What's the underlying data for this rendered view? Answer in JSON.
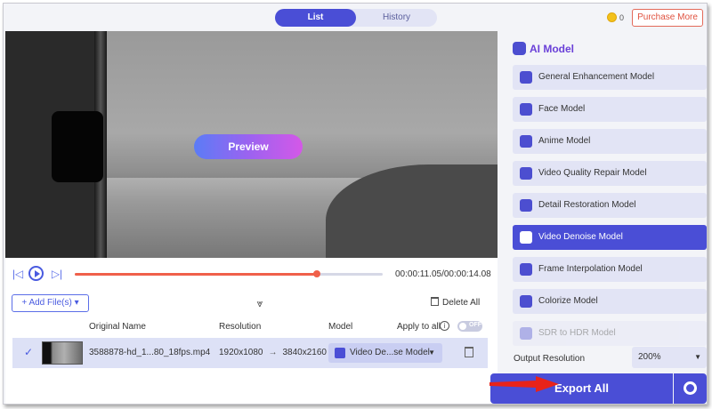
{
  "tabs": [
    {
      "label": "List",
      "active": true
    },
    {
      "label": "History",
      "active": false
    }
  ],
  "header": {
    "coin_count": "0",
    "purchase_label": "Purchase More"
  },
  "preview": {
    "button_label": "Preview"
  },
  "player": {
    "time": "00:00:11.05/00:00:14.08",
    "progress": 0.786
  },
  "filebar": {
    "add_label": "Add File(s)",
    "delete_all_label": "Delete All"
  },
  "table": {
    "columns": {
      "name": "Original Name",
      "resolution": "Resolution",
      "model": "Model",
      "apply_all": "Apply to all",
      "toggle": "OFF"
    },
    "rows": [
      {
        "name": "3588878-hd_1...80_18fps.mp4",
        "res_from": "1920x1080",
        "res_to": "3840x2160",
        "model": "Video De...se Model"
      }
    ]
  },
  "sidebar": {
    "title": "AI Model",
    "models": [
      {
        "label": "General Enhancement Model",
        "icon": "enhance-icon",
        "state": "normal"
      },
      {
        "label": "Face Model",
        "icon": "face-icon",
        "state": "normal"
      },
      {
        "label": "Anime Model",
        "icon": "anime-icon",
        "state": "normal"
      },
      {
        "label": "Video Quality Repair Model",
        "icon": "repair-icon",
        "state": "normal"
      },
      {
        "label": "Detail Restoration Model",
        "icon": "detail-icon",
        "state": "normal"
      },
      {
        "label": "Video Denoise Model",
        "icon": "denoise-icon",
        "state": "active"
      },
      {
        "label": "Frame Interpolation Model",
        "icon": "frame-icon",
        "state": "normal"
      },
      {
        "label": "Colorize Model",
        "icon": "colorize-icon",
        "state": "normal"
      },
      {
        "label": "SDR to HDR Model",
        "icon": "hdr-icon",
        "state": "faded"
      }
    ],
    "output_label": "Output Resolution",
    "output_value": "200%",
    "export_label": "Export All"
  },
  "colors": {
    "accent": "#4a4ed6",
    "progress": "#f0604a",
    "purchase": "#e0523f"
  }
}
